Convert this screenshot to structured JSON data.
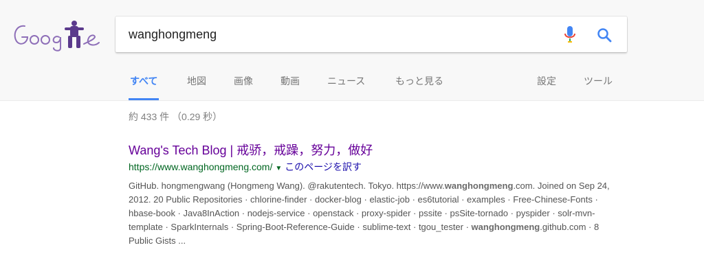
{
  "search": {
    "query": "wanghongmeng"
  },
  "tabs": [
    {
      "label": "すべて"
    },
    {
      "label": "地図"
    },
    {
      "label": "画像"
    },
    {
      "label": "動画"
    },
    {
      "label": "ニュース"
    },
    {
      "label": "もっと見る"
    },
    {
      "label": "設定"
    },
    {
      "label": "ツール"
    }
  ],
  "stats": "約 433 件 （0.29 秒）",
  "result": {
    "title": "Wang's Tech Blog | 戒骄，戒躁，努力，做好",
    "url": "https://www.wanghongmeng.com/",
    "translate_label": "このページを訳す",
    "snippet": {
      "p1": "GitHub. hongmengwang (Hongmeng Wang). @rakutentech. Tokyo. https://www.",
      "b1": "wanghongmeng",
      "p2": ".com. Joined on Sep 24, 2012. 20 Public Repositories · chlorine-finder · docker-blog · elastic-job · es6tutorial · examples · Free-Chinese-Fonts · hbase-book · Java8InAction · nodejs-service · openstack · proxy-spider · pssite · psSite-tornado · pyspider · solr-mvn-template · SparkInternals · Spring-Boot-Reference-Guide · sublime-text · tgou_tester · ",
      "b2": "wanghongmeng",
      "p3": ".github.com · 8 Public Gists ..."
    }
  },
  "colors": {
    "accent": "#4285f4",
    "visited_link": "#660099",
    "url_green": "#006621"
  }
}
